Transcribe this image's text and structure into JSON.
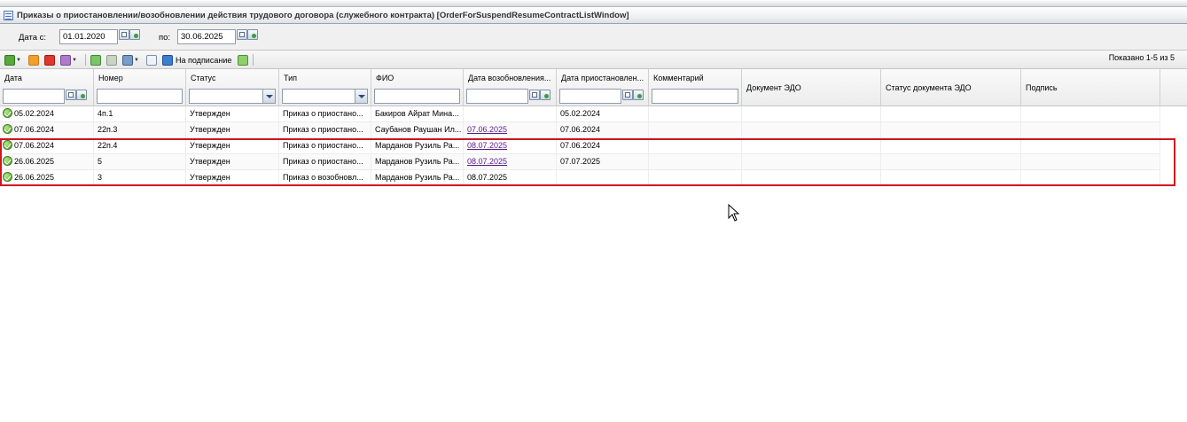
{
  "window": {
    "title": "Приказы о приостановлении/возобновлении действия трудового договора (служебного контракта) [OrderForSuspendResumeContractListWindow]"
  },
  "filters": {
    "date_from_label": "Дата с:",
    "date_from_value": "01.01.2020",
    "date_to_label": "по:",
    "date_to_value": "30.06.2025"
  },
  "toolbar": {
    "add_icon": "add-icon",
    "edit_icon": "edit-icon",
    "delete_icon": "delete-icon",
    "actions_icon": "actions-icon",
    "approve_icon": "approve-icon",
    "unapprove_icon": "unapprove-icon",
    "print_icon": "print-icon",
    "export_icon": "export-icon",
    "sign_label": "На подписание",
    "refresh_icon": "refresh-icon",
    "shown_text": "Показано 1-5 из 5"
  },
  "table": {
    "columns": [
      "Дата",
      "Номер",
      "Статус",
      "Тип",
      "ФИО",
      "Дата возобновления...",
      "Дата приостановлен...",
      "Комментарий",
      "Документ ЭДО",
      "Статус документа ЭДО",
      "Подпись"
    ],
    "rows": [
      {
        "date": "05.02.2024",
        "number": "4п.1",
        "status": "Утвержден",
        "type": "Приказ о приостано...",
        "fio": "Бакиров Айрат Мина...",
        "resume_date": "",
        "suspend_date": "05.02.2024",
        "comment": "",
        "edo_doc": "",
        "edo_status": "",
        "signature": ""
      },
      {
        "date": "07.06.2024",
        "number": "22п.3",
        "status": "Утвержден",
        "type": "Приказ о приостано...",
        "fio": "Саубанов Раушан Ил...",
        "resume_date": "07.06.2025",
        "suspend_date": "07.06.2024",
        "comment": "",
        "edo_doc": "",
        "edo_status": "",
        "signature": ""
      },
      {
        "date": "07.06.2024",
        "number": "22п.4",
        "status": "Утвержден",
        "type": "Приказ о приостано...",
        "fio": "Марданов Рузиль Ра...",
        "resume_date": "08.07.2025",
        "suspend_date": "07.06.2024",
        "comment": "",
        "edo_doc": "",
        "edo_status": "",
        "signature": ""
      },
      {
        "date": "26.06.2025",
        "number": "5",
        "status": "Утвержден",
        "type": "Приказ о приостано...",
        "fio": "Марданов Рузиль Ра...",
        "resume_date": "08.07.2025",
        "suspend_date": "07.07.2025",
        "comment": "",
        "edo_doc": "",
        "edo_status": "",
        "signature": ""
      },
      {
        "date": "26.06.2025",
        "number": "3",
        "status": "Утвержден",
        "type": "Приказ о возобновл...",
        "fio": "Марданов Рузиль Ра...",
        "resume_date": "08.07.2025",
        "suspend_date": "",
        "comment": "",
        "edo_doc": "",
        "edo_status": "",
        "signature": ""
      }
    ]
  },
  "colors": {
    "highlight": "#d0141e",
    "link": "#551a8b",
    "status_ok": "#4a9c24"
  }
}
